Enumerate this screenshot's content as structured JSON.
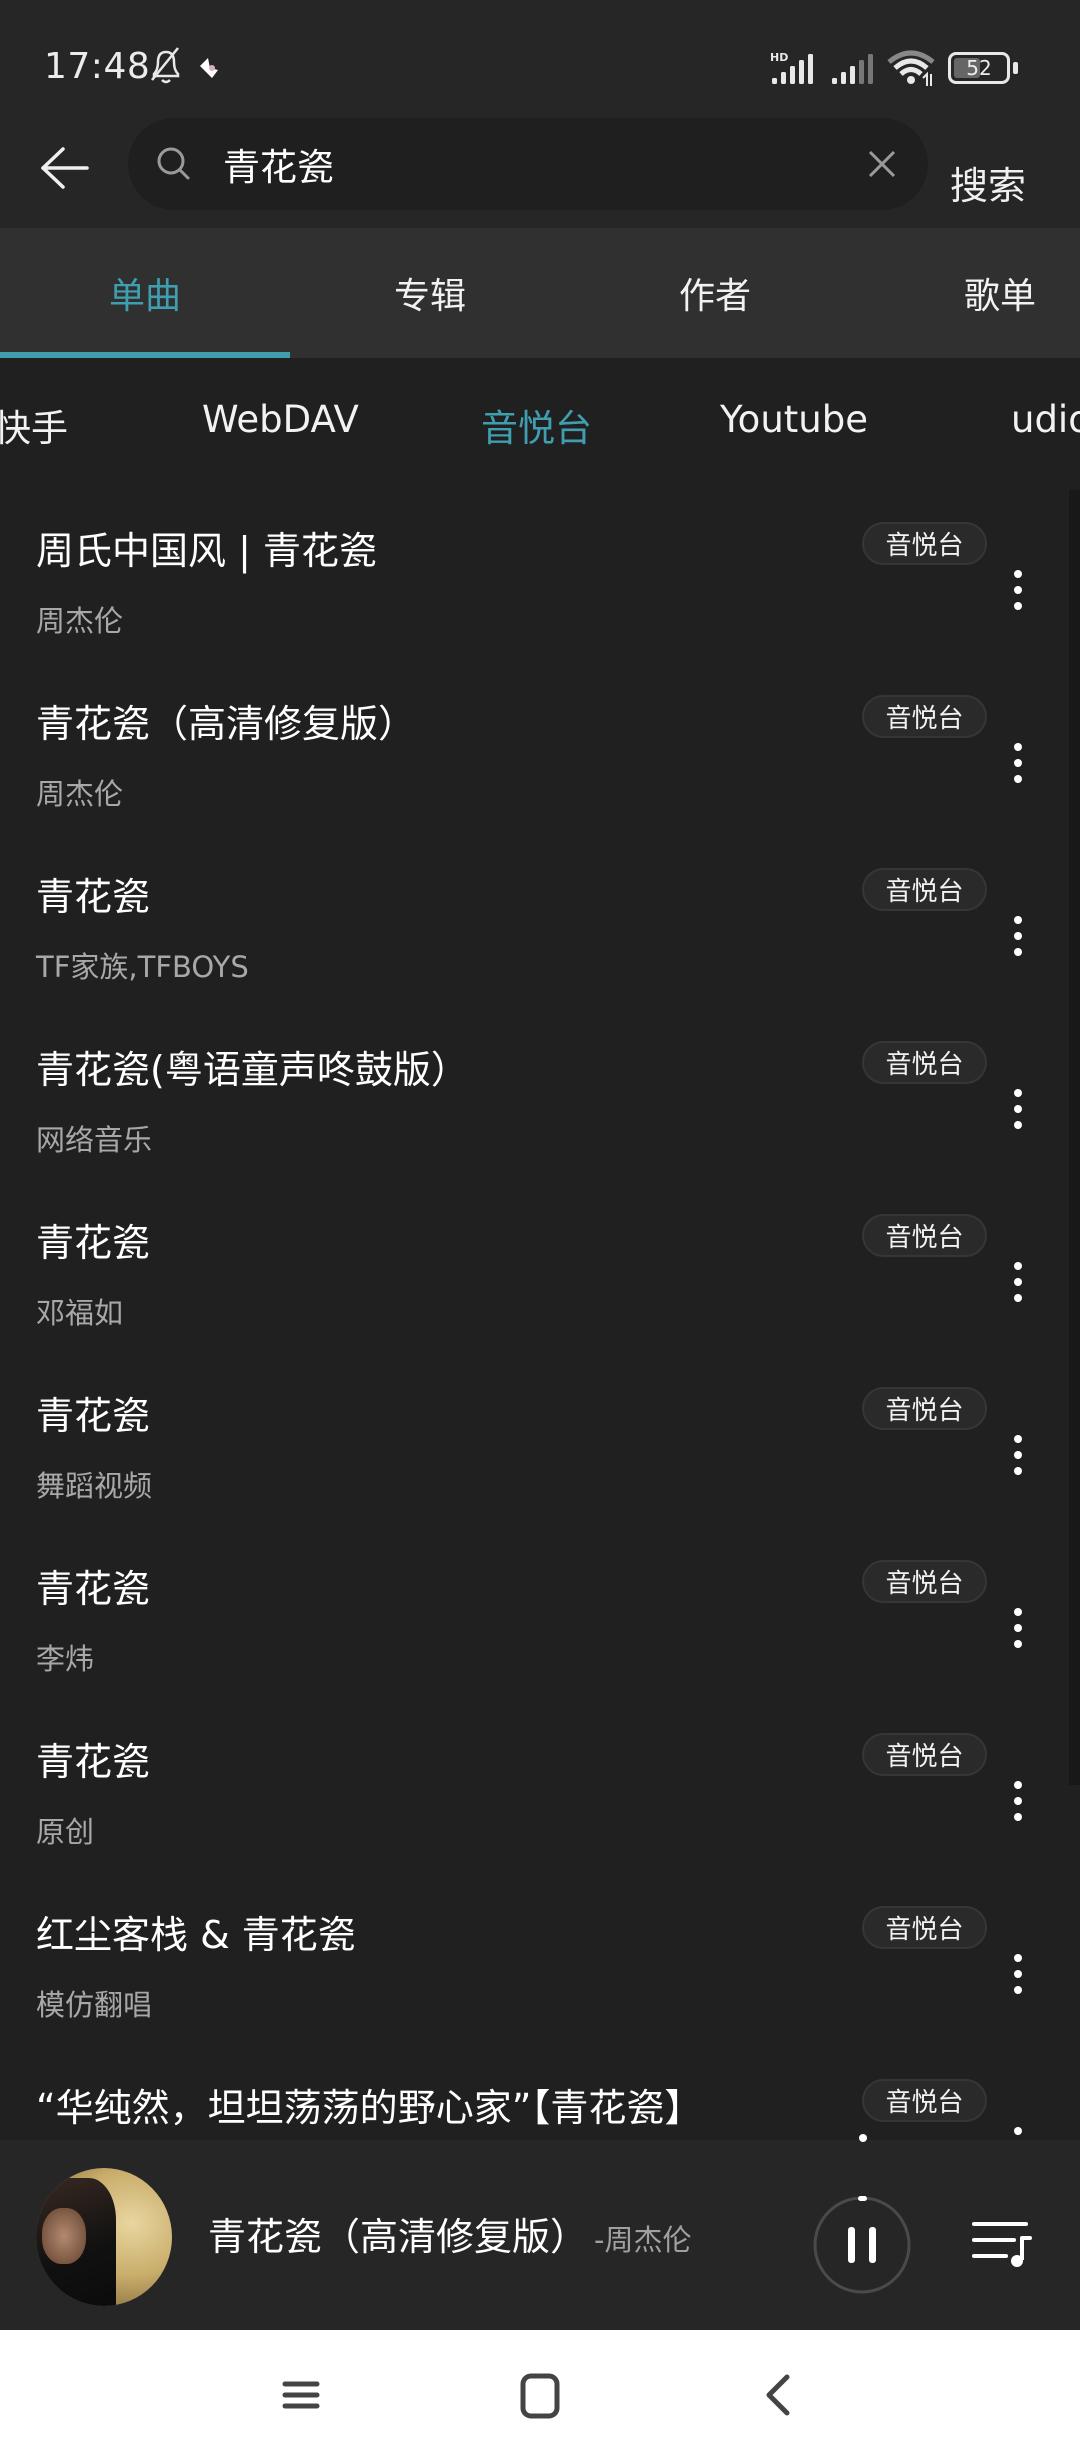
{
  "status_bar": {
    "time": "17:48",
    "icons": [
      "bell-muted-icon",
      "app-notification-icon",
      "hd-signal-icon",
      "signal-icon",
      "wifi-icon",
      "battery-icon"
    ],
    "signal_label": "HD",
    "battery_percent": 52
  },
  "search": {
    "query": "青花瓷",
    "submit_label": "搜索",
    "icons": {
      "back": "arrow-left-icon",
      "search": "search-icon",
      "clear": "close-icon"
    }
  },
  "tabs": {
    "items": [
      {
        "label": "单曲",
        "active": true
      },
      {
        "label": "专辑",
        "active": false
      },
      {
        "label": "作者",
        "active": false
      },
      {
        "label": "歌单",
        "active": false
      }
    ]
  },
  "sources": {
    "items": [
      {
        "label": "快手",
        "active": false
      },
      {
        "label": "WebDAV",
        "active": false
      },
      {
        "label": "音悦台",
        "active": true
      },
      {
        "label": "Youtube",
        "active": false
      },
      {
        "label": "udio",
        "active": false
      }
    ]
  },
  "songs": [
    {
      "title": "周氏中国风 | 青花瓷",
      "artist": "周杰伦",
      "source": "音悦台"
    },
    {
      "title": "青花瓷（高清修复版）",
      "artist": "周杰伦",
      "source": "音悦台"
    },
    {
      "title": "青花瓷",
      "artist": "TF家族,TFBOYS",
      "source": "音悦台"
    },
    {
      "title": "青花瓷(粤语童声咚鼓版）",
      "artist": "网络音乐",
      "source": "音悦台"
    },
    {
      "title": "青花瓷",
      "artist": "邓福如",
      "source": "音悦台"
    },
    {
      "title": "青花瓷",
      "artist": "舞蹈视频",
      "source": "音悦台"
    },
    {
      "title": "青花瓷",
      "artist": "李炜",
      "source": "音悦台"
    },
    {
      "title": "青花瓷",
      "artist": "原创",
      "source": "音悦台"
    },
    {
      "title": "红尘客栈 & 青花瓷",
      "artist": "模仿翻唱",
      "source": "音悦台"
    },
    {
      "title": "“华纯然，坦坦荡荡的野心家”【青花瓷】",
      "artist": "",
      "source": "音悦台"
    }
  ],
  "player": {
    "title": "青花瓷（高清修复版）",
    "artist": "-周杰伦",
    "state": "playing",
    "progress": 0.01
  },
  "navbar": {
    "buttons": [
      "menu-icon",
      "home-icon",
      "back-icon"
    ]
  },
  "colors": {
    "accent": "#3f9fb0",
    "background": "#202020",
    "header": "#262626",
    "tab_bar": "#303030"
  }
}
